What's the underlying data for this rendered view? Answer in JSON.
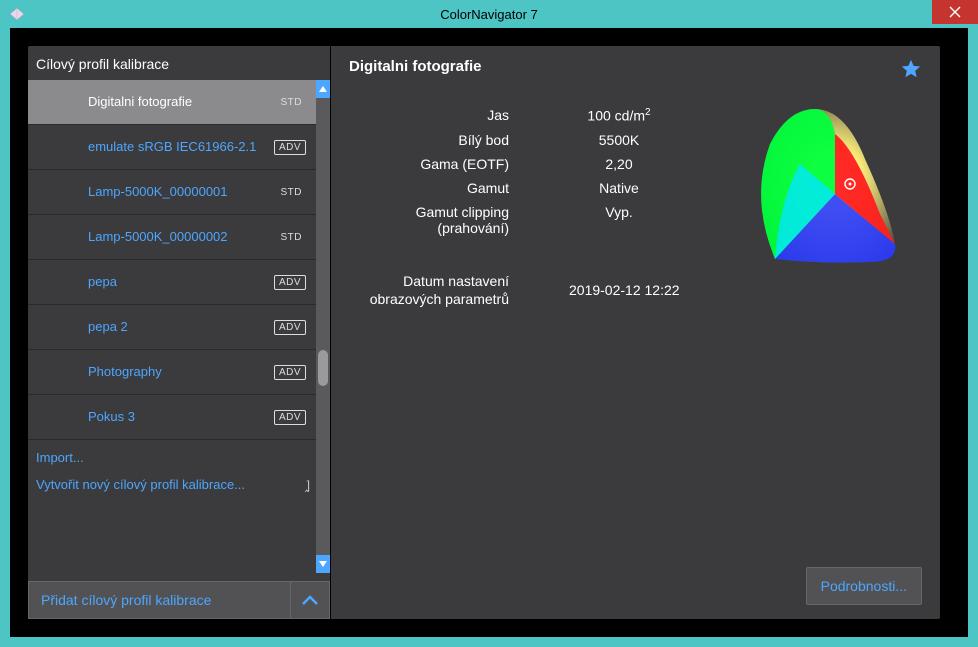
{
  "window": {
    "title": "ColorNavigator 7"
  },
  "sidebar": {
    "header": "Cílový profil kalibrace",
    "items": [
      {
        "label": "Digitalni fotografie",
        "badge": "STD",
        "badge_type": "std",
        "selected": true
      },
      {
        "label": "emulate sRGB IEC61966-2.1",
        "badge": "ADV",
        "badge_type": "adv",
        "selected": false
      },
      {
        "label": "Lamp-5000K_00000001",
        "badge": "STD",
        "badge_type": "std",
        "selected": false
      },
      {
        "label": "Lamp-5000K_00000002",
        "badge": "STD",
        "badge_type": "std",
        "selected": false
      },
      {
        "label": "pepa",
        "badge": "ADV",
        "badge_type": "adv",
        "selected": false
      },
      {
        "label": "pepa 2",
        "badge": "ADV",
        "badge_type": "adv",
        "selected": false
      },
      {
        "label": "Photography",
        "badge": "ADV",
        "badge_type": "adv",
        "selected": false
      },
      {
        "label": "Pokus 3",
        "badge": "ADV",
        "badge_type": "adv",
        "selected": false
      }
    ],
    "import_label": "Import...",
    "create_label": "Vytvořit nový cílový profil kalibrace...",
    "add_label": "Přidat cílový profil kalibrace"
  },
  "main": {
    "title": "Digitalni fotografie",
    "rows": {
      "brightness": {
        "label": "Jas",
        "value": "100 cd/m",
        "sup": "2"
      },
      "whitepoint": {
        "label": "Bílý bod",
        "value": "5500K"
      },
      "gamma": {
        "label": "Gama (EOTF)",
        "value": "2,20"
      },
      "gamut": {
        "label": "Gamut",
        "value": "Native"
      },
      "clipping": {
        "label": "Gamut clipping (prahování)",
        "value": "Vyp."
      }
    },
    "date": {
      "label": "Datum nastavení obrazových parametrů",
      "value": "2019-02-12 12:22"
    },
    "details_button": "Podrobnosti..."
  }
}
